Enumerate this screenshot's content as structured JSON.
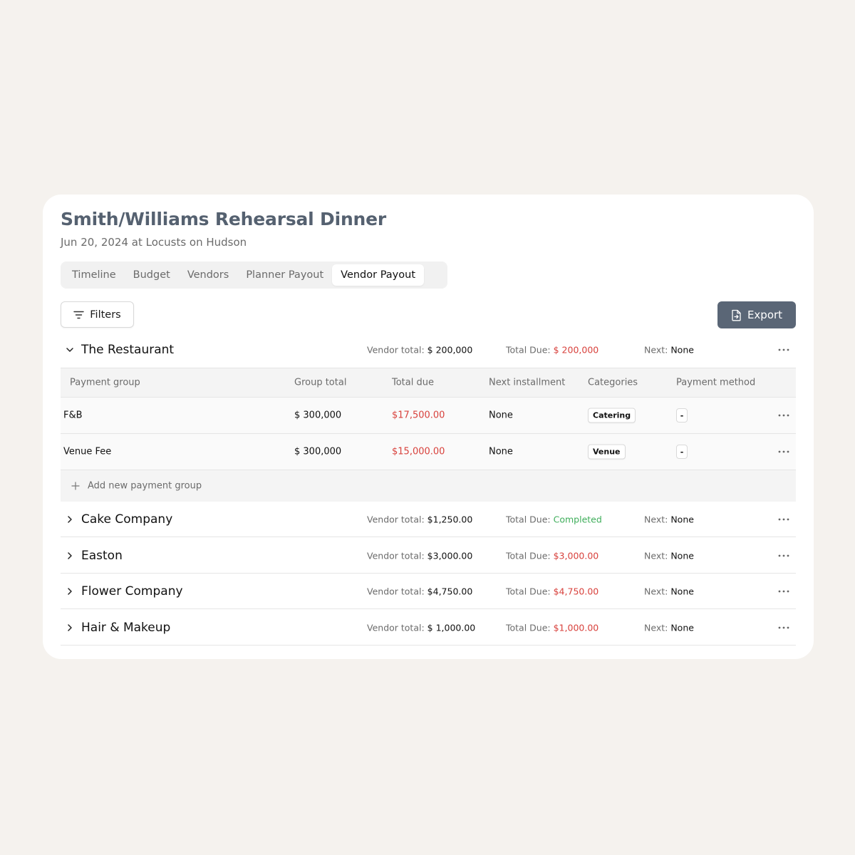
{
  "header": {
    "title": "Smith/Williams Rehearsal Dinner",
    "subtitle": "Jun 20, 2024 at Locusts on Hudson"
  },
  "tabs": [
    {
      "label": "Timeline",
      "active": false
    },
    {
      "label": "Budget",
      "active": false
    },
    {
      "label": "Vendors",
      "active": false
    },
    {
      "label": "Planner Payout",
      "active": false
    },
    {
      "label": "Vendor Payout",
      "active": true
    }
  ],
  "toolbar": {
    "filters_label": "Filters",
    "export_label": "Export"
  },
  "labels": {
    "vendor_total": "Vendor total:",
    "total_due": "Total Due:",
    "next": "Next:"
  },
  "vendors": [
    {
      "name": "The Restaurant",
      "expanded": true,
      "vendor_total": "$ 200,000",
      "total_due": "$ 200,000",
      "due_status": "due",
      "next": "None"
    },
    {
      "name": "Cake Company",
      "expanded": false,
      "vendor_total": "$1,250.00",
      "total_due": "Completed",
      "due_status": "completed",
      "next": "None"
    },
    {
      "name": "Easton",
      "expanded": false,
      "vendor_total": "$3,000.00",
      "total_due": "$3,000.00",
      "due_status": "due",
      "next": "None"
    },
    {
      "name": "Flower Company",
      "expanded": false,
      "vendor_total": "$4,750.00",
      "total_due": "$4,750.00",
      "due_status": "due",
      "next": "None"
    },
    {
      "name": "Hair & Makeup",
      "expanded": false,
      "vendor_total": "$ 1,000.00",
      "total_due": "$1,000.00",
      "due_status": "due",
      "next": "None"
    }
  ],
  "payment_table": {
    "columns": [
      "Payment group",
      "Group total",
      "Total due",
      "Next installment",
      "Categories",
      "Payment method"
    ],
    "rows": [
      {
        "group": "F&B",
        "group_total": "$ 300,000",
        "total_due": "$17,500.00",
        "next_installment": "None",
        "category": "Catering",
        "payment_method": "-"
      },
      {
        "group": "Venue Fee",
        "group_total": "$ 300,000",
        "total_due": "$15,000.00",
        "next_installment": "None",
        "category": "Venue",
        "payment_method": "-"
      }
    ],
    "add_label": "Add new payment group"
  },
  "colors": {
    "background": "#f5f2ee",
    "title": "#556170",
    "export_button": "#5a6676",
    "due_red": "#d8413c",
    "completed_green": "#3fae5b"
  },
  "icons": {
    "filters": "filter-lines-icon",
    "export": "file-export-icon",
    "expand": "chevron-icon",
    "more": "more-dots-icon",
    "add": "plus-icon"
  }
}
